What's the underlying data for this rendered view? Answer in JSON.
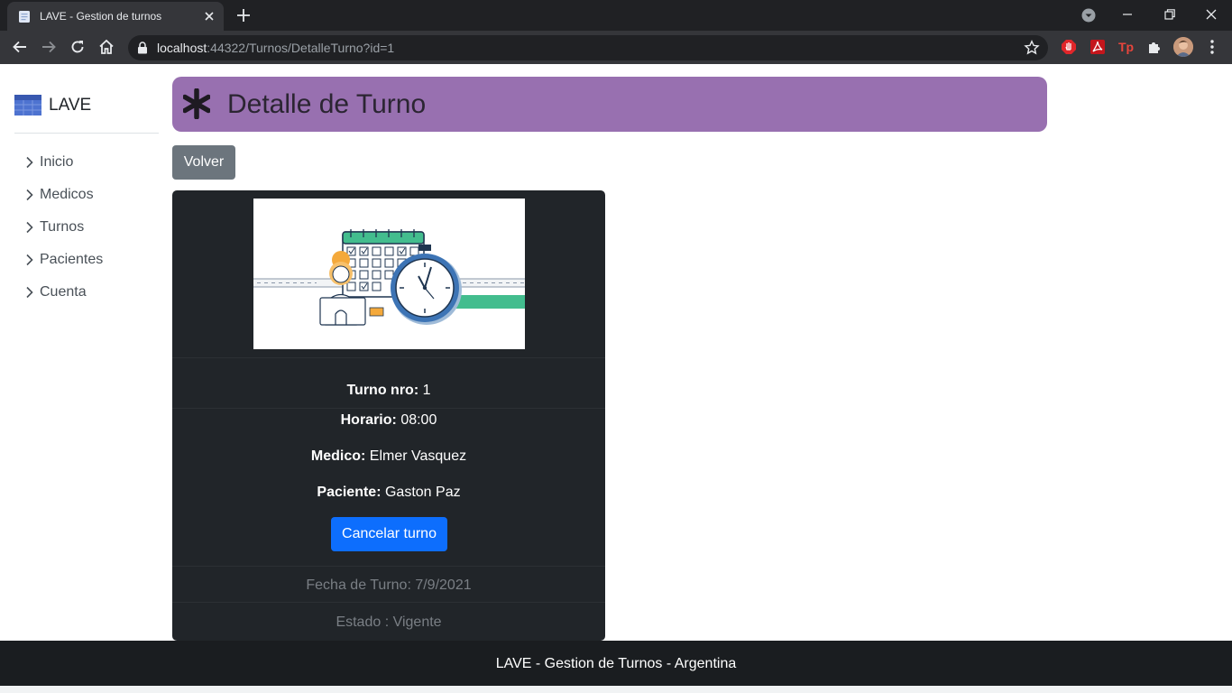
{
  "browser": {
    "tab_title": "LAVE - Gestion de turnos",
    "url_host": "localhost",
    "url_rest": ":44322/Turnos/DetalleTurno?id=1",
    "colors": {
      "tabbar": "#202124",
      "toolbar": "#35363a"
    }
  },
  "sidebar": {
    "brand": "LAVE",
    "items": [
      {
        "label": "Inicio",
        "icon": "chevron-right-icon"
      },
      {
        "label": "Medicos",
        "icon": "chevron-right-icon"
      },
      {
        "label": "Turnos",
        "icon": "chevron-right-icon"
      },
      {
        "label": "Pacientes",
        "icon": "chevron-right-icon"
      },
      {
        "label": "Cuenta",
        "icon": "chevron-right-icon"
      }
    ]
  },
  "header": {
    "title": "Detalle de Turno",
    "icon": "asterisk-icon",
    "color": "#9870b0"
  },
  "actions": {
    "back_label": "Volver"
  },
  "turno": {
    "numero_label": "Turno nro:",
    "numero": "1",
    "horario_label": "Horario:",
    "horario": "08:00",
    "medico_label": "Medico:",
    "medico": "Elmer Vasquez",
    "paciente_label": "Paciente:",
    "paciente": "Gaston Paz",
    "cancel_label": "Cancelar turno",
    "fecha": "Fecha de Turno: 7/9/2021",
    "estado": "Estado : Vigente"
  },
  "footer": {
    "text": "LAVE - Gestion de Turnos - Argentina"
  }
}
